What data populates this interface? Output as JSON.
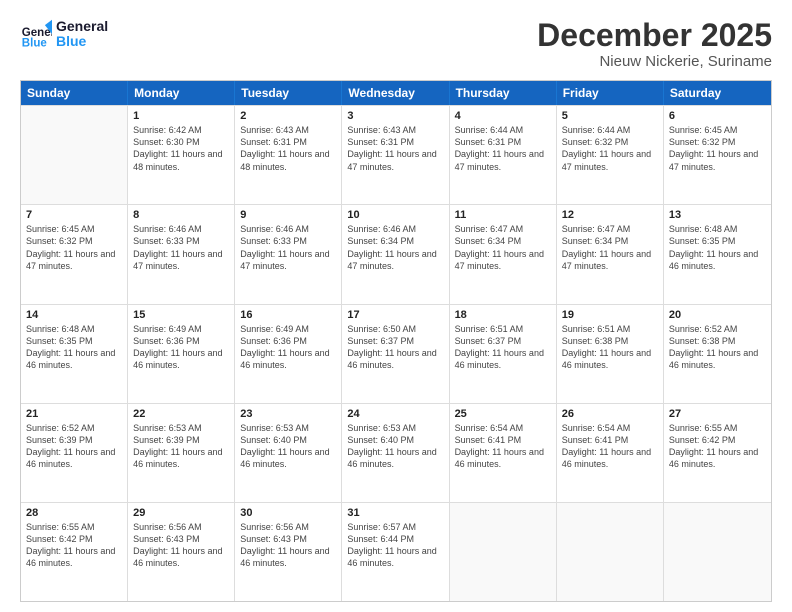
{
  "logo": {
    "text_general": "General",
    "text_blue": "Blue"
  },
  "title": "December 2025",
  "subtitle": "Nieuw Nickerie, Suriname",
  "header_days": [
    "Sunday",
    "Monday",
    "Tuesday",
    "Wednesday",
    "Thursday",
    "Friday",
    "Saturday"
  ],
  "rows": [
    [
      {
        "day": "",
        "sunrise": "",
        "sunset": "",
        "daylight": ""
      },
      {
        "day": "1",
        "sunrise": "Sunrise: 6:42 AM",
        "sunset": "Sunset: 6:30 PM",
        "daylight": "Daylight: 11 hours and 48 minutes."
      },
      {
        "day": "2",
        "sunrise": "Sunrise: 6:43 AM",
        "sunset": "Sunset: 6:31 PM",
        "daylight": "Daylight: 11 hours and 48 minutes."
      },
      {
        "day": "3",
        "sunrise": "Sunrise: 6:43 AM",
        "sunset": "Sunset: 6:31 PM",
        "daylight": "Daylight: 11 hours and 47 minutes."
      },
      {
        "day": "4",
        "sunrise": "Sunrise: 6:44 AM",
        "sunset": "Sunset: 6:31 PM",
        "daylight": "Daylight: 11 hours and 47 minutes."
      },
      {
        "day": "5",
        "sunrise": "Sunrise: 6:44 AM",
        "sunset": "Sunset: 6:32 PM",
        "daylight": "Daylight: 11 hours and 47 minutes."
      },
      {
        "day": "6",
        "sunrise": "Sunrise: 6:45 AM",
        "sunset": "Sunset: 6:32 PM",
        "daylight": "Daylight: 11 hours and 47 minutes."
      }
    ],
    [
      {
        "day": "7",
        "sunrise": "Sunrise: 6:45 AM",
        "sunset": "Sunset: 6:32 PM",
        "daylight": "Daylight: 11 hours and 47 minutes."
      },
      {
        "day": "8",
        "sunrise": "Sunrise: 6:46 AM",
        "sunset": "Sunset: 6:33 PM",
        "daylight": "Daylight: 11 hours and 47 minutes."
      },
      {
        "day": "9",
        "sunrise": "Sunrise: 6:46 AM",
        "sunset": "Sunset: 6:33 PM",
        "daylight": "Daylight: 11 hours and 47 minutes."
      },
      {
        "day": "10",
        "sunrise": "Sunrise: 6:46 AM",
        "sunset": "Sunset: 6:34 PM",
        "daylight": "Daylight: 11 hours and 47 minutes."
      },
      {
        "day": "11",
        "sunrise": "Sunrise: 6:47 AM",
        "sunset": "Sunset: 6:34 PM",
        "daylight": "Daylight: 11 hours and 47 minutes."
      },
      {
        "day": "12",
        "sunrise": "Sunrise: 6:47 AM",
        "sunset": "Sunset: 6:34 PM",
        "daylight": "Daylight: 11 hours and 47 minutes."
      },
      {
        "day": "13",
        "sunrise": "Sunrise: 6:48 AM",
        "sunset": "Sunset: 6:35 PM",
        "daylight": "Daylight: 11 hours and 46 minutes."
      }
    ],
    [
      {
        "day": "14",
        "sunrise": "Sunrise: 6:48 AM",
        "sunset": "Sunset: 6:35 PM",
        "daylight": "Daylight: 11 hours and 46 minutes."
      },
      {
        "day": "15",
        "sunrise": "Sunrise: 6:49 AM",
        "sunset": "Sunset: 6:36 PM",
        "daylight": "Daylight: 11 hours and 46 minutes."
      },
      {
        "day": "16",
        "sunrise": "Sunrise: 6:49 AM",
        "sunset": "Sunset: 6:36 PM",
        "daylight": "Daylight: 11 hours and 46 minutes."
      },
      {
        "day": "17",
        "sunrise": "Sunrise: 6:50 AM",
        "sunset": "Sunset: 6:37 PM",
        "daylight": "Daylight: 11 hours and 46 minutes."
      },
      {
        "day": "18",
        "sunrise": "Sunrise: 6:51 AM",
        "sunset": "Sunset: 6:37 PM",
        "daylight": "Daylight: 11 hours and 46 minutes."
      },
      {
        "day": "19",
        "sunrise": "Sunrise: 6:51 AM",
        "sunset": "Sunset: 6:38 PM",
        "daylight": "Daylight: 11 hours and 46 minutes."
      },
      {
        "day": "20",
        "sunrise": "Sunrise: 6:52 AM",
        "sunset": "Sunset: 6:38 PM",
        "daylight": "Daylight: 11 hours and 46 minutes."
      }
    ],
    [
      {
        "day": "21",
        "sunrise": "Sunrise: 6:52 AM",
        "sunset": "Sunset: 6:39 PM",
        "daylight": "Daylight: 11 hours and 46 minutes."
      },
      {
        "day": "22",
        "sunrise": "Sunrise: 6:53 AM",
        "sunset": "Sunset: 6:39 PM",
        "daylight": "Daylight: 11 hours and 46 minutes."
      },
      {
        "day": "23",
        "sunrise": "Sunrise: 6:53 AM",
        "sunset": "Sunset: 6:40 PM",
        "daylight": "Daylight: 11 hours and 46 minutes."
      },
      {
        "day": "24",
        "sunrise": "Sunrise: 6:53 AM",
        "sunset": "Sunset: 6:40 PM",
        "daylight": "Daylight: 11 hours and 46 minutes."
      },
      {
        "day": "25",
        "sunrise": "Sunrise: 6:54 AM",
        "sunset": "Sunset: 6:41 PM",
        "daylight": "Daylight: 11 hours and 46 minutes."
      },
      {
        "day": "26",
        "sunrise": "Sunrise: 6:54 AM",
        "sunset": "Sunset: 6:41 PM",
        "daylight": "Daylight: 11 hours and 46 minutes."
      },
      {
        "day": "27",
        "sunrise": "Sunrise: 6:55 AM",
        "sunset": "Sunset: 6:42 PM",
        "daylight": "Daylight: 11 hours and 46 minutes."
      }
    ],
    [
      {
        "day": "28",
        "sunrise": "Sunrise: 6:55 AM",
        "sunset": "Sunset: 6:42 PM",
        "daylight": "Daylight: 11 hours and 46 minutes."
      },
      {
        "day": "29",
        "sunrise": "Sunrise: 6:56 AM",
        "sunset": "Sunset: 6:43 PM",
        "daylight": "Daylight: 11 hours and 46 minutes."
      },
      {
        "day": "30",
        "sunrise": "Sunrise: 6:56 AM",
        "sunset": "Sunset: 6:43 PM",
        "daylight": "Daylight: 11 hours and 46 minutes."
      },
      {
        "day": "31",
        "sunrise": "Sunrise: 6:57 AM",
        "sunset": "Sunset: 6:44 PM",
        "daylight": "Daylight: 11 hours and 46 minutes."
      },
      {
        "day": "",
        "sunrise": "",
        "sunset": "",
        "daylight": ""
      },
      {
        "day": "",
        "sunrise": "",
        "sunset": "",
        "daylight": ""
      },
      {
        "day": "",
        "sunrise": "",
        "sunset": "",
        "daylight": ""
      }
    ]
  ]
}
